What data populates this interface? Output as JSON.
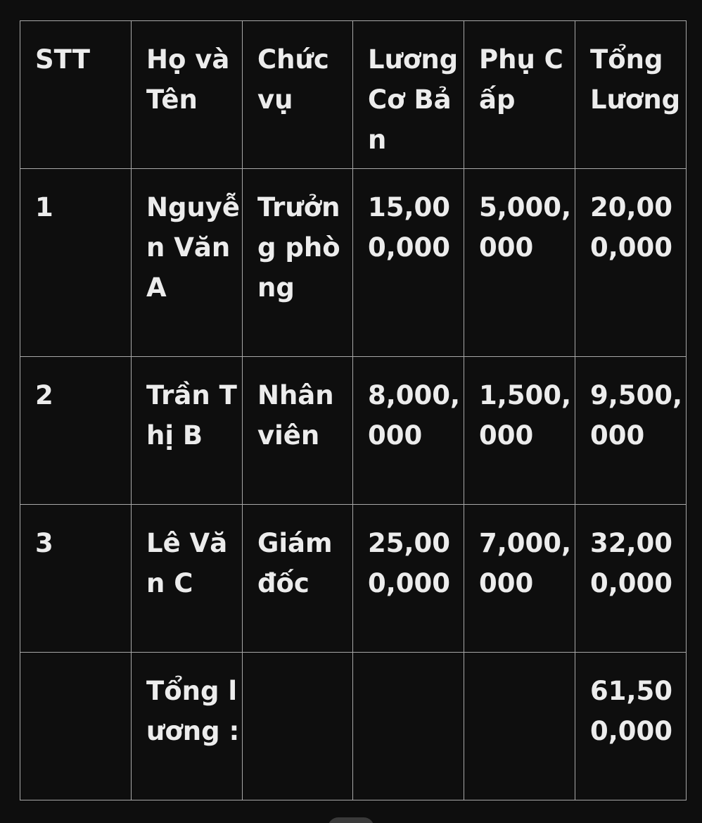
{
  "table": {
    "headers": [
      "STT",
      "Họ và Tên",
      "Chức vụ",
      "Lương Cơ Bản",
      "Phụ Cấp",
      "Tổng Lương"
    ],
    "rows": [
      [
        "1",
        "Nguyễn Văn A",
        "Trưởng phòng",
        "15,000,000",
        "5,000,000",
        "20,000,000"
      ],
      [
        "2",
        "Trần Thị B",
        "Nhân viên",
        "8,000,000",
        "1,500,000",
        "9,500,000"
      ],
      [
        "3",
        "Lê Văn C",
        "Giám đốc",
        "25,000,000",
        "7,000,000",
        "32,000,000"
      ]
    ],
    "total": {
      "label": "Tổng lương :",
      "value": "61,500,000"
    }
  }
}
